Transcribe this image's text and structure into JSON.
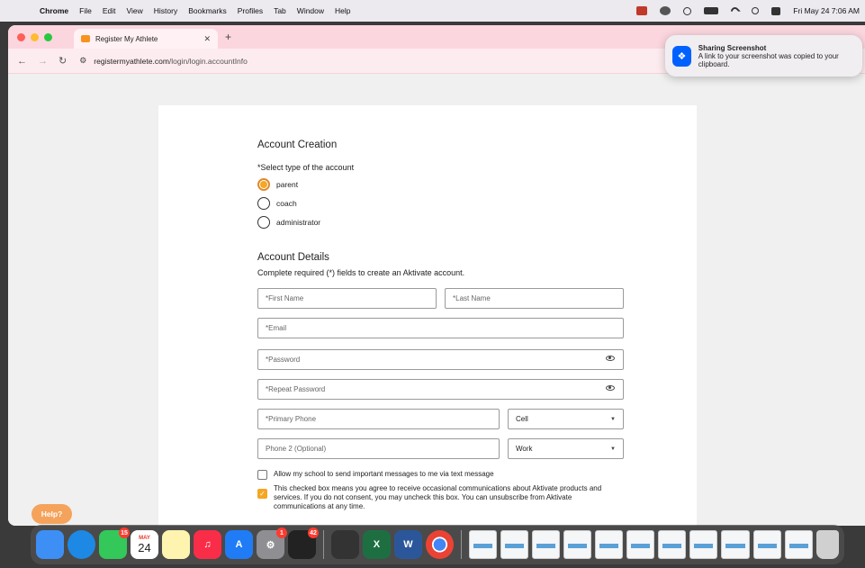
{
  "menubar": {
    "app_name": "Chrome",
    "menus": [
      "File",
      "Edit",
      "View",
      "History",
      "Bookmarks",
      "Profiles",
      "Tab",
      "Window",
      "Help"
    ],
    "clock": "Fri May 24  7:06 AM"
  },
  "browser": {
    "tab_title": "Register My Athlete",
    "url_host": "registermyathlete.com",
    "url_path": "/login/login.accountInfo"
  },
  "notification": {
    "title": "Sharing Screenshot",
    "message": "A link to your screenshot was copied to your clipboard."
  },
  "form": {
    "account_creation_title": "Account Creation",
    "type_prompt": "*Select type of the account",
    "account_types": [
      {
        "label": "parent",
        "selected": true
      },
      {
        "label": "coach",
        "selected": false
      },
      {
        "label": "administrator",
        "selected": false
      }
    ],
    "details_title": "Account Details",
    "details_subtitle": "Complete required (*) fields to create an Aktivate account.",
    "first_name_placeholder": "*First Name",
    "last_name_placeholder": "*Last Name",
    "email_placeholder": "*Email",
    "password_placeholder": "*Password",
    "repeat_password_placeholder": "*Repeat Password",
    "primary_phone_placeholder": "*Primary Phone",
    "primary_phone_type": "Cell",
    "phone2_placeholder": "Phone 2 (Optional)",
    "phone2_type": "Work",
    "sms_consent_label": "Allow my school to send important messages to me via text message",
    "sms_consent_checked": false,
    "marketing_consent_label": "This checked box means you agree to receive occasional communications about Aktivate products and services. If you do not consent, you may uncheck this box. You can unsubscribe from Aktivate communications at any time.",
    "marketing_consent_checked": true
  },
  "help_button": "Help?",
  "dock": {
    "calendar_month": "MAY",
    "calendar_day": "24",
    "messages_badge": "15",
    "system_settings_badge": "1",
    "perplexity_badge": "42"
  },
  "colors": {
    "accent_orange": "#f5a623",
    "tab_strip_pink": "#fbd6de",
    "help_button": "#f5a35b"
  }
}
